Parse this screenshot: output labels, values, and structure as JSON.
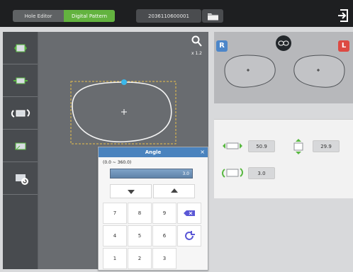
{
  "top": {
    "modes": [
      "Hole Editor",
      "Digital Pattern"
    ],
    "file_number": "2036110600001"
  },
  "canvas": {
    "zoom": "x 1.2"
  },
  "lens": {
    "right_badge": "R",
    "left_badge": "L"
  },
  "measurements": [
    "50.9",
    "29.9",
    "3.0"
  ],
  "dialog": {
    "title": "Angle",
    "range": "(0.0 ~ 360.0)",
    "value": "3.0",
    "close": "×",
    "keys": [
      "7",
      "8",
      "9",
      "4",
      "5",
      "6",
      "1",
      "2",
      "3"
    ]
  },
  "colors": {
    "accent": "#63b33f",
    "blue": "#4a83be",
    "red": "#dd4a43"
  }
}
